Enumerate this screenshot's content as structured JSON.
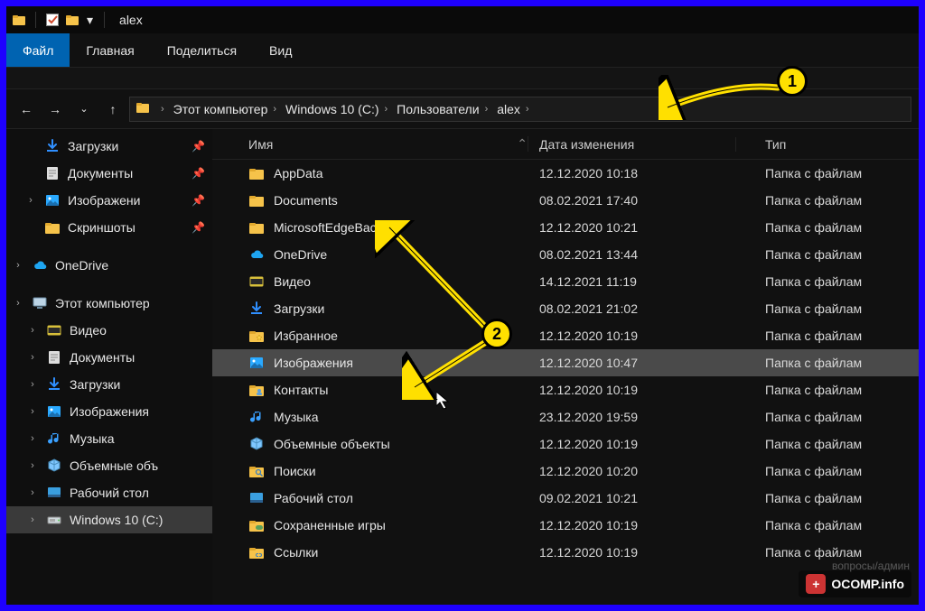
{
  "title": "alex",
  "ribbon": {
    "file": "Файл",
    "tabs": [
      "Главная",
      "Поделиться",
      "Вид"
    ]
  },
  "breadcrumb": [
    "Этот компьютер",
    "Windows 10 (C:)",
    "Пользователи",
    "alex"
  ],
  "columns": {
    "name": "Имя",
    "date": "Дата изменения",
    "type": "Тип"
  },
  "folderType": "Папка с файлам",
  "navQuick": [
    {
      "label": "Загрузки",
      "icon": "download",
      "color": "#2f8fff",
      "pinned": true
    },
    {
      "label": "Документы",
      "icon": "doc",
      "color": "#ddd",
      "pinned": true
    },
    {
      "label": "Изображени",
      "icon": "pic",
      "color": "#2aa9ff",
      "pinned": true,
      "expand": true
    },
    {
      "label": "Скриншоты",
      "icon": "folder",
      "color": "#f6c34a",
      "pinned": true
    }
  ],
  "navOneDrive": {
    "label": "OneDrive",
    "icon": "cloud",
    "color": "#1ea5f1"
  },
  "navPC": {
    "label": "Этот компьютер",
    "icon": "pc",
    "color": "#bcd4e6"
  },
  "navPCItems": [
    {
      "label": "Видео",
      "icon": "video",
      "color": "#d8c03a"
    },
    {
      "label": "Документы",
      "icon": "doc",
      "color": "#ddd"
    },
    {
      "label": "Загрузки",
      "icon": "download",
      "color": "#2f8fff"
    },
    {
      "label": "Изображения",
      "icon": "pic",
      "color": "#2aa9ff"
    },
    {
      "label": "Музыка",
      "icon": "music",
      "color": "#3aa0ff"
    },
    {
      "label": "Объемные объ",
      "icon": "cube",
      "color": "#7fc7ff"
    },
    {
      "label": "Рабочий стол",
      "icon": "desk",
      "color": "#3a9fe0"
    },
    {
      "label": "Windows 10 (C:)",
      "icon": "disk",
      "color": "#cfd8dc",
      "sel": true
    }
  ],
  "rows": [
    {
      "name": "AppData",
      "date": "12.12.2020 10:18",
      "icon": "folder",
      "color": "#f6c34a"
    },
    {
      "name": "Documents",
      "date": "08.02.2021 17:40",
      "icon": "folder",
      "color": "#f6c34a"
    },
    {
      "name": "MicrosoftEdgeBackups",
      "date": "12.12.2020 10:21",
      "icon": "folder",
      "color": "#f6c34a"
    },
    {
      "name": "OneDrive",
      "date": "08.02.2021 13:44",
      "icon": "cloud",
      "color": "#1ea5f1"
    },
    {
      "name": "Видео",
      "date": "14.12.2021 11:19",
      "icon": "video",
      "color": "#d8c03a"
    },
    {
      "name": "Загрузки",
      "date": "08.02.2021 21:02",
      "icon": "download",
      "color": "#2f8fff"
    },
    {
      "name": "Избранное",
      "date": "12.12.2020 10:19",
      "icon": "folderstar",
      "color": "#f6c34a"
    },
    {
      "name": "Изображения",
      "date": "12.12.2020 10:47",
      "icon": "pic",
      "color": "#2aa9ff",
      "sel": true
    },
    {
      "name": "Контакты",
      "date": "12.12.2020 10:19",
      "icon": "foldercontact",
      "color": "#f6c34a"
    },
    {
      "name": "Музыка",
      "date": "23.12.2020 19:59",
      "icon": "music",
      "color": "#3aa0ff"
    },
    {
      "name": "Объемные объекты",
      "date": "12.12.2020 10:19",
      "icon": "cube",
      "color": "#7fc7ff"
    },
    {
      "name": "Поиски",
      "date": "12.12.2020 10:20",
      "icon": "foldersearch",
      "color": "#f6c34a"
    },
    {
      "name": "Рабочий стол",
      "date": "09.02.2021 10:21",
      "icon": "desk",
      "color": "#3a9fe0"
    },
    {
      "name": "Сохраненные игры",
      "date": "12.12.2020 10:19",
      "icon": "foldergame",
      "color": "#f6c34a"
    },
    {
      "name": "Ссылки",
      "date": "12.12.2020 10:19",
      "icon": "folderlink",
      "color": "#f6c34a"
    }
  ],
  "callouts": {
    "one": "1",
    "two": "2"
  },
  "watermark": "OCOMP.info",
  "subwatermark": "вопросы/админ"
}
